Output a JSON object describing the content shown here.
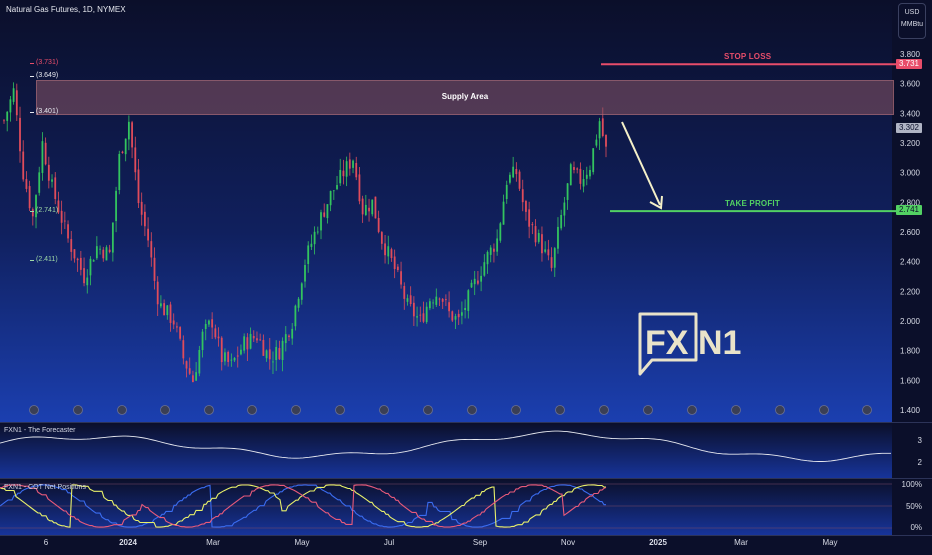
{
  "header": {
    "title": "Natural Gas Futures, 1D, NYMEX",
    "currency": "USD",
    "unit": "MMBtu"
  },
  "colors": {
    "bg_top": "#0b0f2a",
    "bg_bottom": "#1b3fb0",
    "up": "#33c45f",
    "down": "#e04c5b",
    "stop": "#e84d6a",
    "target": "#52d163",
    "supply": "#8a5664"
  },
  "annotations": {
    "supply_area": "Supply Area",
    "stop_loss": "STOP LOSS",
    "take_profit": "TAKE PROFIT",
    "levels": [
      "(3.731)",
      "(3.649)",
      "(3.401)",
      "(2.741)",
      "(2.411)"
    ],
    "tag_stop": "3.731",
    "tag_last": "3.302",
    "tag_target": "2.741"
  },
  "logo": {
    "text_left": "FX",
    "text_right": "N1"
  },
  "indicators": {
    "forecaster": {
      "title": "FXN1 - The Forecaster",
      "ticks": [
        "3",
        "2"
      ]
    },
    "cot": {
      "title": "FXN1 - COT Net Positions",
      "ticks": [
        "100%",
        "50%",
        "0%"
      ]
    }
  },
  "chart_data": {
    "type": "candlestick",
    "title": "Natural Gas Futures, 1D, NYMEX",
    "ylim": [
      1.4,
      3.9
    ],
    "y_ticks": [
      "3.800",
      "3.600",
      "3.400",
      "3.200",
      "3.000",
      "2.800",
      "2.600",
      "2.400",
      "2.200",
      "2.000",
      "1.800",
      "1.600",
      "1.400"
    ],
    "x_ticks": [
      "6",
      "2024",
      "Mar",
      "May",
      "Jul",
      "Sep",
      "Nov",
      "2025",
      "Mar",
      "May"
    ],
    "levels": {
      "stop_loss": 3.731,
      "take_profit": 2.741,
      "last": 3.302,
      "supply_area": [
        3.401,
        3.649
      ]
    },
    "close_path": [
      [
        0,
        3.35
      ],
      [
        6,
        3.55
      ],
      [
        12,
        3.0
      ],
      [
        18,
        2.7
      ],
      [
        24,
        3.2
      ],
      [
        30,
        2.9
      ],
      [
        40,
        2.55
      ],
      [
        50,
        2.3
      ],
      [
        58,
        2.5
      ],
      [
        66,
        2.45
      ],
      [
        72,
        3.1
      ],
      [
        78,
        3.35
      ],
      [
        84,
        2.8
      ],
      [
        90,
        2.55
      ],
      [
        95,
        2.2
      ],
      [
        98,
        2.1
      ],
      [
        106,
        2.0
      ],
      [
        112,
        1.75
      ],
      [
        118,
        1.6
      ],
      [
        124,
        1.9
      ],
      [
        130,
        2.0
      ],
      [
        136,
        1.75
      ],
      [
        142,
        1.7
      ],
      [
        150,
        1.85
      ],
      [
        158,
        1.9
      ],
      [
        166,
        1.75
      ],
      [
        172,
        1.8
      ],
      [
        180,
        2.0
      ],
      [
        188,
        2.4
      ],
      [
        196,
        2.65
      ],
      [
        204,
        2.85
      ],
      [
        212,
        3.0
      ],
      [
        218,
        3.1
      ],
      [
        224,
        2.75
      ],
      [
        230,
        2.8
      ],
      [
        236,
        2.55
      ],
      [
        244,
        2.35
      ],
      [
        252,
        2.1
      ],
      [
        260,
        2.0
      ],
      [
        266,
        2.15
      ],
      [
        272,
        2.2
      ],
      [
        278,
        2.05
      ],
      [
        284,
        2.0
      ],
      [
        292,
        2.2
      ],
      [
        300,
        2.4
      ],
      [
        308,
        2.55
      ],
      [
        314,
        2.95
      ],
      [
        320,
        3.0
      ],
      [
        326,
        2.7
      ],
      [
        334,
        2.55
      ],
      [
        338,
        2.45
      ],
      [
        342,
        2.35
      ],
      [
        348,
        2.7
      ],
      [
        354,
        3.0
      ],
      [
        360,
        2.95
      ],
      [
        366,
        3.05
      ],
      [
        372,
        3.35
      ],
      [
        376,
        3.15
      ]
    ],
    "forecaster": {
      "ylim": [
        1.3,
        3.8
      ]
    },
    "cot": {
      "ylim": [
        0,
        100
      ]
    }
  }
}
